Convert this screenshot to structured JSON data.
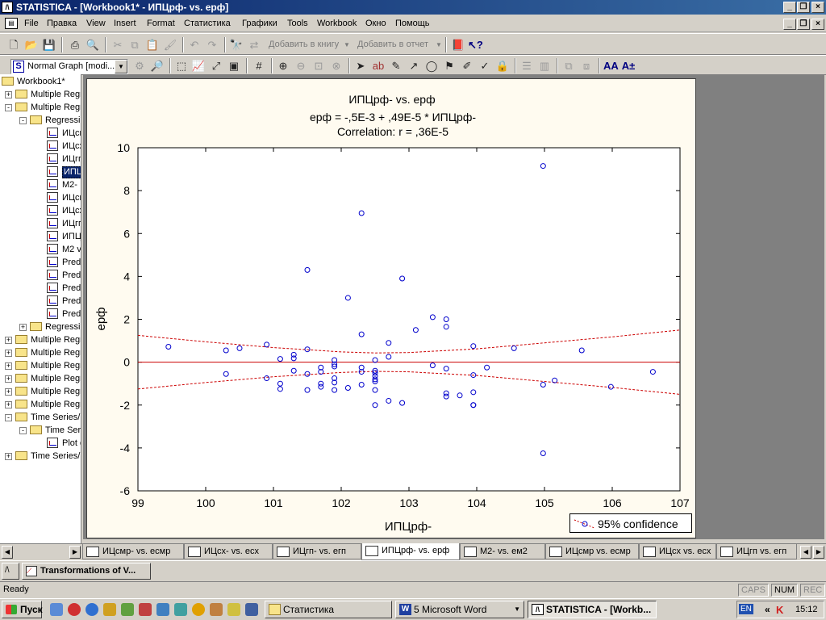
{
  "window": {
    "title": "STATISTICA - [Workbook1* - ИПЦрф-   vs. ерф]",
    "app_icon": "statistica-icon"
  },
  "menu": [
    "File",
    "Правка",
    "View",
    "Insert",
    "Format",
    "Статистика",
    "Графики",
    "Tools",
    "Workbook",
    "Окно",
    "Помощь"
  ],
  "toolbar": {
    "add_to_book": "Добавить в книгу",
    "add_to_report": "Добавить в отчет",
    "graph_type_selected": "Normal Graph [modi..."
  },
  "tree": {
    "root": "Workbook1*",
    "items": [
      "Multiple Regr",
      "Multiple Regr",
      "Regressi",
      "ИЦсм",
      "ИЦсх",
      "ИЦгп",
      "ИПЦ",
      "М2-",
      "ИЦсм",
      "ИЦсх",
      "ИЦгп",
      "ИПЦ",
      "М2 v",
      "Pred",
      "Pred",
      "Pred",
      "Pred",
      "Pred",
      "Regressi",
      "Multiple Regr",
      "Multiple Regr",
      "Multiple Regr",
      "Multiple Regr",
      "Multiple Regr",
      "Multiple Regr",
      "Time Series/F",
      "Time Ser",
      "Plot o",
      "Time Series/F"
    ],
    "selected_index": 6
  },
  "chart_data": {
    "type": "scatter",
    "title": "ИПЦрф-   vs. ерф",
    "equation": "ерф      = -,5E-3 + ,49E-5 * ИПЦрф-",
    "correlation": "Correlation: r = ,36E-5",
    "xlabel": "ИПЦрф-",
    "ylabel": "ерф",
    "xlim": [
      99,
      107
    ],
    "ylim": [
      -6,
      10
    ],
    "xticks": [
      "99",
      "100",
      "101",
      "102",
      "103",
      "104",
      "105",
      "106",
      "107"
    ],
    "yticks": [
      "10",
      "8",
      "6",
      "4",
      "2",
      "0",
      "-2",
      "-4",
      "-6"
    ],
    "legend": "95% confidence",
    "legend_position": "bottom-right",
    "regression_line": {
      "intercept": -0.0005,
      "slope": 4.9e-06,
      "color": "#cc0000"
    },
    "confidence_band": {
      "x": [
        99,
        100,
        101,
        102,
        102.5,
        103,
        104,
        105,
        106,
        107
      ],
      "upper": [
        1.25,
        0.95,
        0.68,
        0.48,
        0.43,
        0.45,
        0.62,
        0.9,
        1.18,
        1.5
      ],
      "lower": [
        -1.25,
        -0.95,
        -0.68,
        -0.48,
        -0.43,
        -0.45,
        -0.62,
        -0.9,
        -1.18,
        -1.5
      ],
      "color": "#cc0000"
    },
    "points": {
      "color": "#0000cc",
      "x": [
        99.45,
        100.3,
        100.3,
        100.5,
        100.9,
        100.9,
        101.1,
        101.1,
        101.1,
        101.3,
        101.3,
        101.3,
        101.5,
        101.5,
        101.5,
        101.5,
        101.7,
        101.7,
        101.7,
        101.7,
        101.9,
        101.9,
        101.9,
        101.9,
        101.9,
        101.9,
        102.1,
        102.1,
        102.3,
        102.3,
        102.3,
        102.3,
        102.3,
        102.5,
        102.5,
        102.5,
        102.5,
        102.5,
        102.5,
        102.5,
        102.5,
        102.7,
        102.7,
        102.7,
        102.9,
        102.9,
        103.1,
        103.35,
        103.35,
        103.55,
        103.55,
        103.55,
        103.55,
        103.55,
        103.75,
        103.95,
        103.95,
        103.95,
        103.95,
        103.95,
        104.15,
        104.55,
        104.98,
        104.98,
        104.98,
        105.15,
        105.55,
        105.98,
        106.6
      ],
      "y": [
        0.72,
        0.55,
        -0.55,
        0.65,
        0.82,
        -0.75,
        0.15,
        -1.0,
        -1.25,
        0.35,
        0.18,
        -0.4,
        4.3,
        0.6,
        -0.55,
        -1.3,
        -0.25,
        -0.45,
        -1.0,
        -1.15,
        0.1,
        -0.1,
        -0.2,
        -0.75,
        -0.95,
        -1.3,
        3.0,
        -1.2,
        6.95,
        1.3,
        -0.25,
        -0.45,
        -1.05,
        0.1,
        -0.4,
        -0.5,
        -0.65,
        -0.8,
        -0.9,
        -1.3,
        -2.0,
        0.9,
        0.25,
        -1.8,
        3.9,
        -1.9,
        1.5,
        2.1,
        -0.15,
        2.0,
        1.65,
        -0.3,
        -1.45,
        -1.6,
        -1.55,
        0.75,
        -0.6,
        -1.4,
        -2.0,
        -2.0,
        -0.25,
        0.65,
        9.15,
        -4.25,
        -1.05,
        -0.85,
        0.55,
        -1.15,
        -0.45
      ]
    }
  },
  "sheet_tabs": [
    {
      "label": "ИЦсмр-   vs. есмр",
      "active": false
    },
    {
      "label": "ИЦсх-    vs. есх",
      "active": false
    },
    {
      "label": "ИЦгп-   vs. егп",
      "active": false
    },
    {
      "label": "ИПЦрф-  vs. ерф",
      "active": true
    },
    {
      "label": "М2-       vs. ем2",
      "active": false
    },
    {
      "label": "ИЦсмр vs. есмр",
      "active": false
    },
    {
      "label": "ИЦсх vs. есх",
      "active": false
    },
    {
      "label": "ИЦгп vs. егп",
      "active": false
    }
  ],
  "tasks": {
    "item": "Transformations of V..."
  },
  "status": {
    "text": "Ready",
    "caps": "CAPS",
    "num": "NUM",
    "rec": "REC"
  },
  "taskbar": {
    "start": "Пуск",
    "buttons": [
      {
        "label": "Статистика",
        "icon": "folder-icon"
      },
      {
        "label": "5 Microsoft Word",
        "icon": "word-icon"
      },
      {
        "label": "STATISTICA - [Workb...",
        "icon": "statistica-icon",
        "pressed": true
      }
    ],
    "lang": "EN",
    "clock": "15:12"
  }
}
